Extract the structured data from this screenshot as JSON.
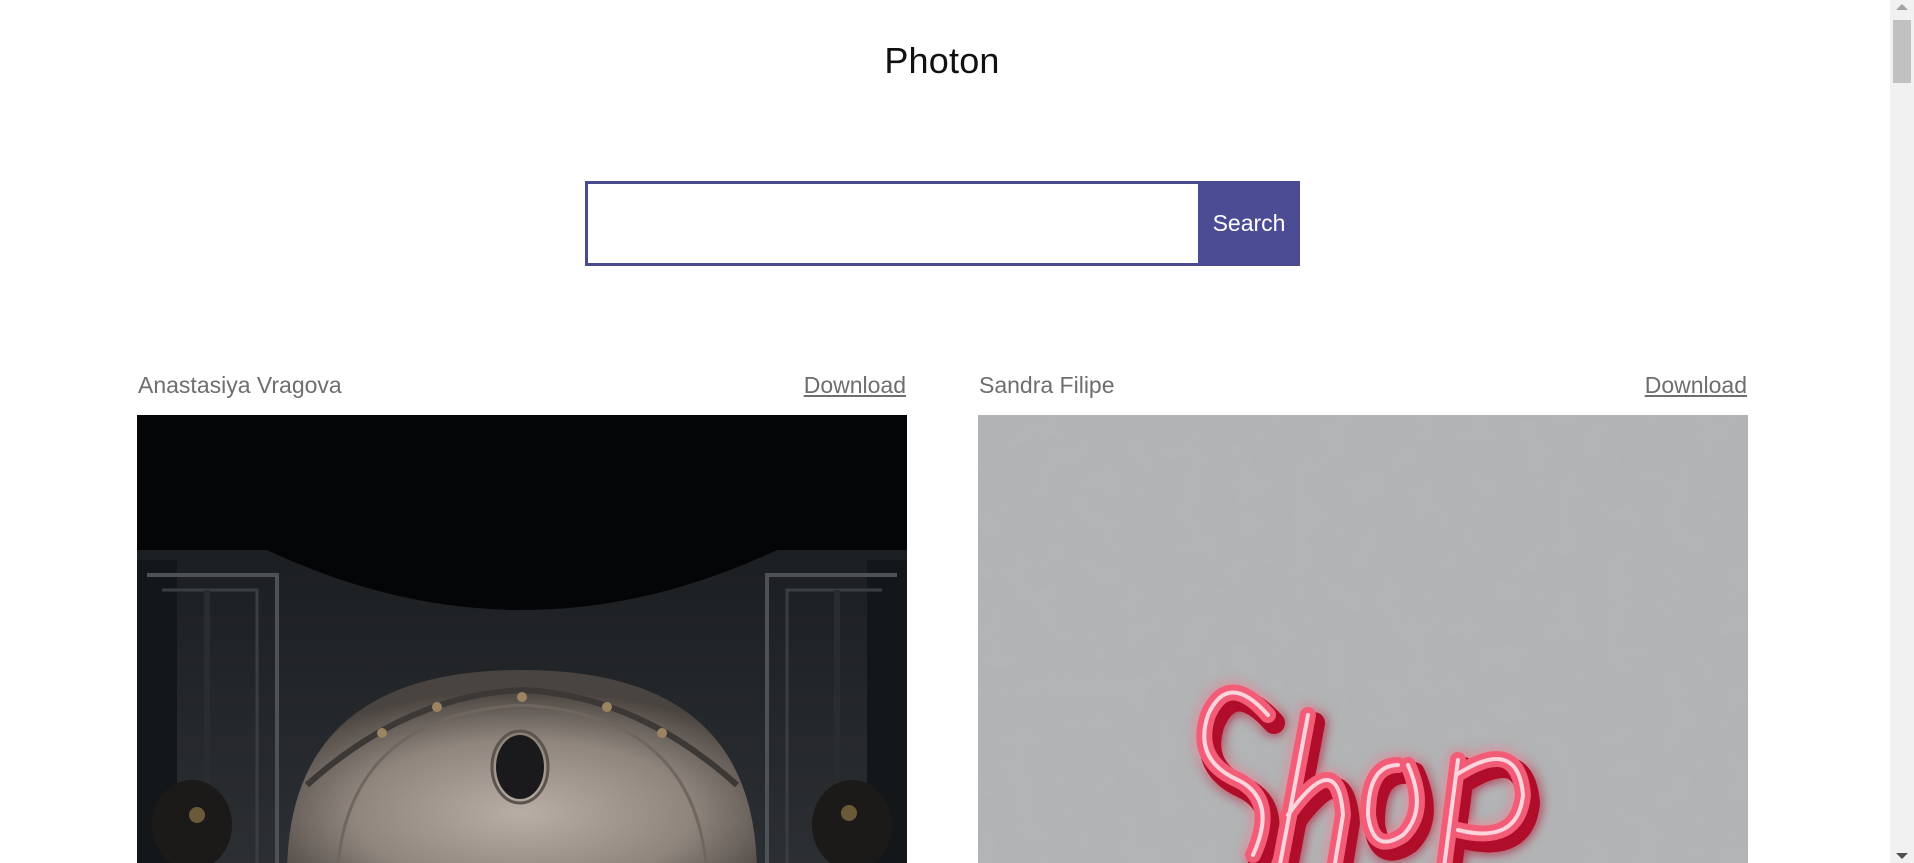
{
  "app": {
    "title": "Photon"
  },
  "search": {
    "value": "",
    "placeholder": "",
    "button_label": "Search"
  },
  "photos": [
    {
      "author": "Anastasiya Vragova",
      "download_label": "Download",
      "image_description": "dark-ornate-ceiling"
    },
    {
      "author": "Sandra Filipe",
      "download_label": "Download",
      "image_description": "neon-shop-sign-on-concrete"
    }
  ],
  "colors": {
    "accent": "#4c4c94",
    "input_border": "#4a4a8f",
    "secondary_text": "#6e6e6e"
  }
}
